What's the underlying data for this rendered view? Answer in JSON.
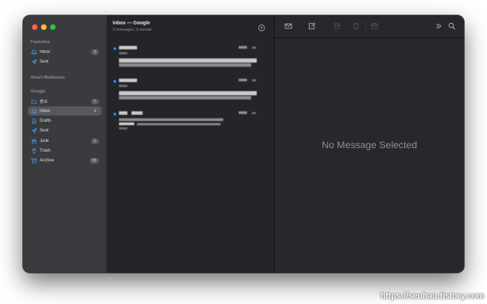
{
  "window": {
    "traffic_lights": [
      "close",
      "minimize",
      "zoom"
    ]
  },
  "sidebar": {
    "favorites_label": "Favorites",
    "favorites": [
      {
        "label": "Inbox",
        "icon": "inbox-icon",
        "badge": "3"
      },
      {
        "label": "Sent",
        "icon": "paper-plane-icon",
        "badge": ""
      }
    ],
    "smart_label": "Smart Mailboxes",
    "account_label": "Google",
    "account_items": [
      {
        "label": "중요",
        "icon": "folder-icon",
        "badge": "1"
      },
      {
        "label": "Inbox",
        "icon": "inbox-icon",
        "badge": "3",
        "selected": true
      },
      {
        "label": "Drafts",
        "icon": "draft-icon",
        "badge": ""
      },
      {
        "label": "Sent",
        "icon": "paper-plane-icon",
        "badge": ""
      },
      {
        "label": "Junk",
        "icon": "junk-icon",
        "badge": "1"
      },
      {
        "label": "Trash",
        "icon": "trash-icon",
        "badge": ""
      },
      {
        "label": "Archive",
        "icon": "archive-icon",
        "badge": "55"
      }
    ]
  },
  "list": {
    "title": "Inbox — Google",
    "subtitle": "3 messages, 3 unread"
  },
  "viewer": {
    "empty_text": "No Message Selected"
  },
  "watermark": "https://seuhau.tistory.com",
  "colors": {
    "accent": "#2e86ff",
    "sidebar": "#3a3b3e",
    "list": "#232528",
    "viewer": "#26282b"
  }
}
